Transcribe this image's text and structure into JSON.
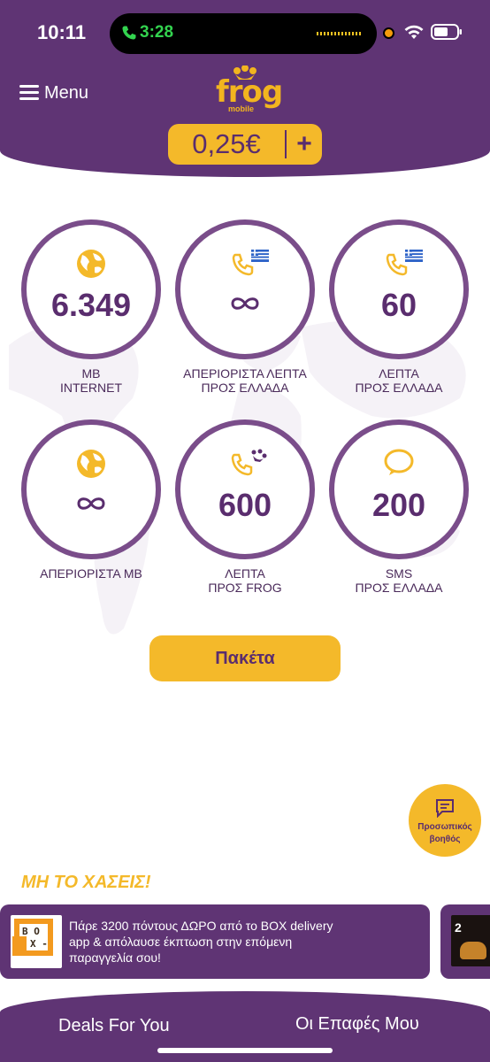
{
  "status_bar": {
    "time": "10:11",
    "call_time": "3:28"
  },
  "header": {
    "menu_label": "Menu",
    "logo_text": "frog",
    "logo_sub": "mobile",
    "balance": "0,25€",
    "add_label": "+"
  },
  "bundles": [
    {
      "value": "6.349",
      "line1": "MB",
      "line2": "INTERNET",
      "icon": "globe-icon"
    },
    {
      "value": "∞",
      "line1": "ΑΠΕΡΙΟΡΙΣΤΑ ΛΕΠΤΑ",
      "line2": "ΠΡΟΣ ΕΛΛΑΔΑ",
      "icon": "phone-greece-icon"
    },
    {
      "value": "60",
      "line1": "ΛΕΠΤΑ",
      "line2": "ΠΡΟΣ ΕΛΛΑΔΑ",
      "icon": "phone-greece-icon"
    },
    {
      "value": "∞",
      "line1": "ΑΠΕΡΙΟΡΙΣΤΑ MB",
      "line2": "",
      "icon": "globe-icon"
    },
    {
      "value": "600",
      "line1": "ΛΕΠΤΑ",
      "line2": "ΠΡΟΣ FROG",
      "icon": "phone-frog-icon"
    },
    {
      "value": "200",
      "line1": "SMS",
      "line2": "ΠΡΟΣ ΕΛΛΑΔΑ",
      "icon": "chat-bubble-icon"
    }
  ],
  "packages_button": "Πακέτα",
  "assistant": {
    "line1": "Προσωπικός",
    "line2": "βοηθός"
  },
  "dont_miss": "ΜΗ ΤΟ ΧΑΣΕΙΣ!",
  "promo": {
    "line1": "Πάρε 3200 πόντους ΔΩΡΟ από το BOX delivery",
    "line2": "app & απόλαυσε έκπτωση στην επόμενη",
    "line3": "παραγγελία σου!",
    "logo_text": "BOX-"
  },
  "promo2": {
    "badge": "2"
  },
  "tabs": {
    "deals": "Deals For You",
    "contacts": "Οι Επαφές Μου"
  },
  "colors": {
    "purple": "#5f3474",
    "yellow": "#f4b92a",
    "ring": "#7a4d8a"
  }
}
